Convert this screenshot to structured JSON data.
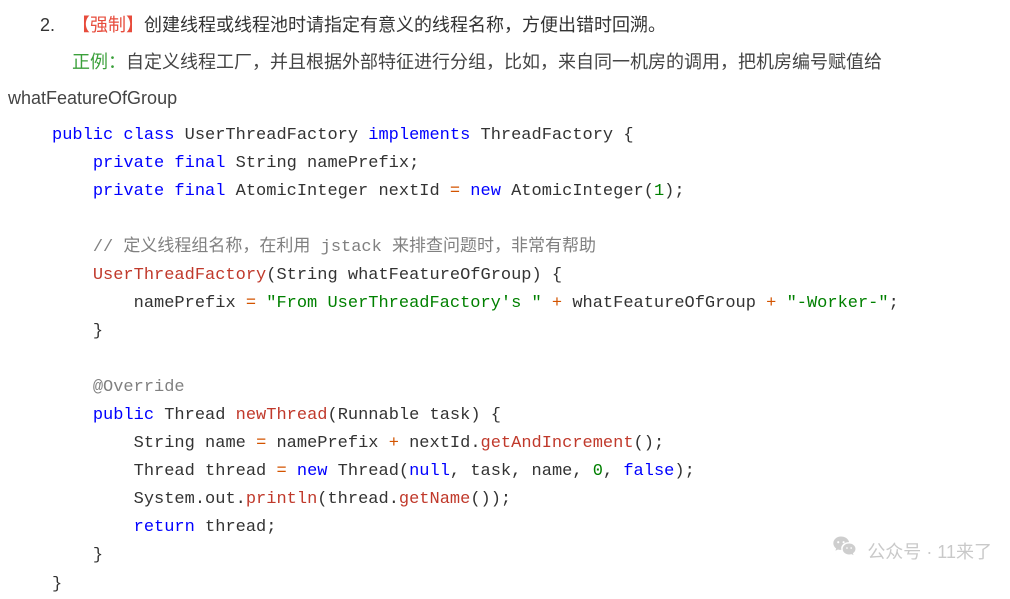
{
  "item_number": "2.",
  "mandatory_tag": "【强制】",
  "title": "创建线程或线程池时请指定有意义的线程名称，方便出错时回溯。",
  "example_label": "正例：",
  "example_text": "自定义线程工厂，并且根据外部特征进行分组，比如，来自同一机房的调用，把机房编号赋值给",
  "sub_text": "whatFeatureOfGroup",
  "code": {
    "l1": {
      "kw1": "public class",
      "type1": "UserThreadFactory",
      "kw2": "implements",
      "type2": "ThreadFactory",
      "p": " {"
    },
    "l2": {
      "kw": "private final",
      "type": "String",
      "var": " namePrefix;"
    },
    "l3": {
      "kw1": "private final",
      "type1": "AtomicInteger",
      "var": " nextId ",
      "op": "=",
      "kw2": " new",
      "type2": " AtomicInteger",
      "p1": "(",
      "n": "1",
      "p2": ");"
    },
    "l4": "",
    "l5": {
      "c": "// 定义线程组名称，在利用 jstack 来排查问题时，非常有帮助"
    },
    "l6": {
      "ctor": "UserThreadFactory",
      "p1": "(",
      "type": "String",
      "arg": " whatFeatureOfGroup",
      "p2": ") {"
    },
    "l7": {
      "pre": "namePrefix ",
      "op": "=",
      "str1": " \"From UserThreadFactory's \"",
      "plus1": " + ",
      "v": "whatFeatureOfGroup",
      "plus2": " + ",
      "str2": "\"-Worker-\"",
      "p": ";"
    },
    "l8": {
      "p": "}"
    },
    "l9": "",
    "l10": {
      "a": "@Override"
    },
    "l11": {
      "kw": "public",
      "type1": " Thread",
      "m": " newThread",
      "p1": "(",
      "type2": "Runnable",
      "arg": " task",
      "p2": ") {"
    },
    "l12": {
      "type": "String",
      "pre": " name ",
      "op": "=",
      "post": " namePrefix ",
      "plus": "+",
      "v": " nextId",
      "dot": ".",
      "m": "getAndIncrement",
      "p": "();"
    },
    "l13": {
      "type": "Thread",
      "pre": " thread ",
      "op": "=",
      "kw": " new",
      "type2": " Thread",
      "p1": "(",
      "n1": "null",
      "c1": ", task, name, ",
      "n2": "0",
      "c2": ", ",
      "b": "false",
      "p2": ");"
    },
    "l14": {
      "pre": "System",
      "dot1": ".",
      "v": "out",
      "dot2": ".",
      "m": "println",
      "p1": "(thread",
      "dot3": ".",
      "m2": "getName",
      "p2": "());"
    },
    "l15": {
      "kw": "return",
      "v": " thread;"
    },
    "l16": {
      "p": "}"
    },
    "l17": {
      "p": "}"
    }
  },
  "watermark": "公众号 · 11来了"
}
